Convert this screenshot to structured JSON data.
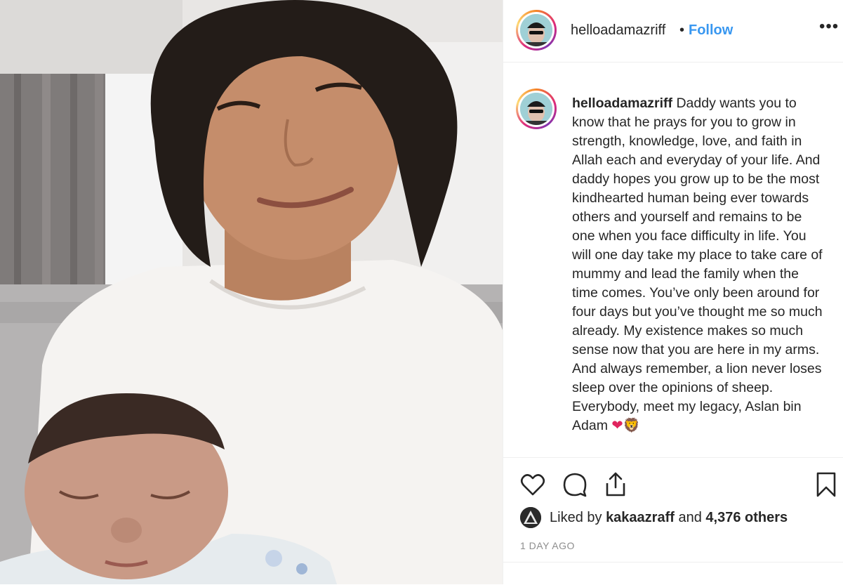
{
  "post": {
    "username": "helloadamazriff",
    "separator": "•",
    "follow_label": "Follow",
    "more_icon": "more-horizontal-icon",
    "more_glyph": "•••"
  },
  "caption": {
    "username": "helloadamazriff",
    "text": "Daddy wants you to know that he prays for you to grow in strength, knowledge, love, and faith in Allah each and everyday of your life. And daddy hopes you grow up to be the most kindhearted human being ever towards others and yourself and remains to be one when you face difficulty in life. You will one day take my place to take care of mummy and lead the family when the time comes. You’ve only been around for four days but you’ve thought me so much already. My existence makes so much sense now that you are here in my arms. And always remember, a lion never loses sleep over the opinions of sheep. Everybody, meet my legacy, Aslan bin Adam",
    "emoji_heart": "❤",
    "emoji_lion": "🦁"
  },
  "actions": {
    "like_icon": "heart-icon",
    "comment_icon": "comment-icon",
    "share_icon": "share-icon",
    "save_icon": "bookmark-icon"
  },
  "likes": {
    "prefix": "Liked by",
    "user": "kakaazraff",
    "middle": "and",
    "others": "4,376 others"
  },
  "timestamp": "1 DAY AGO",
  "colors": {
    "follow": "#3897f0",
    "text": "#262626",
    "muted": "#8e8e8e",
    "border": "#efefef"
  }
}
